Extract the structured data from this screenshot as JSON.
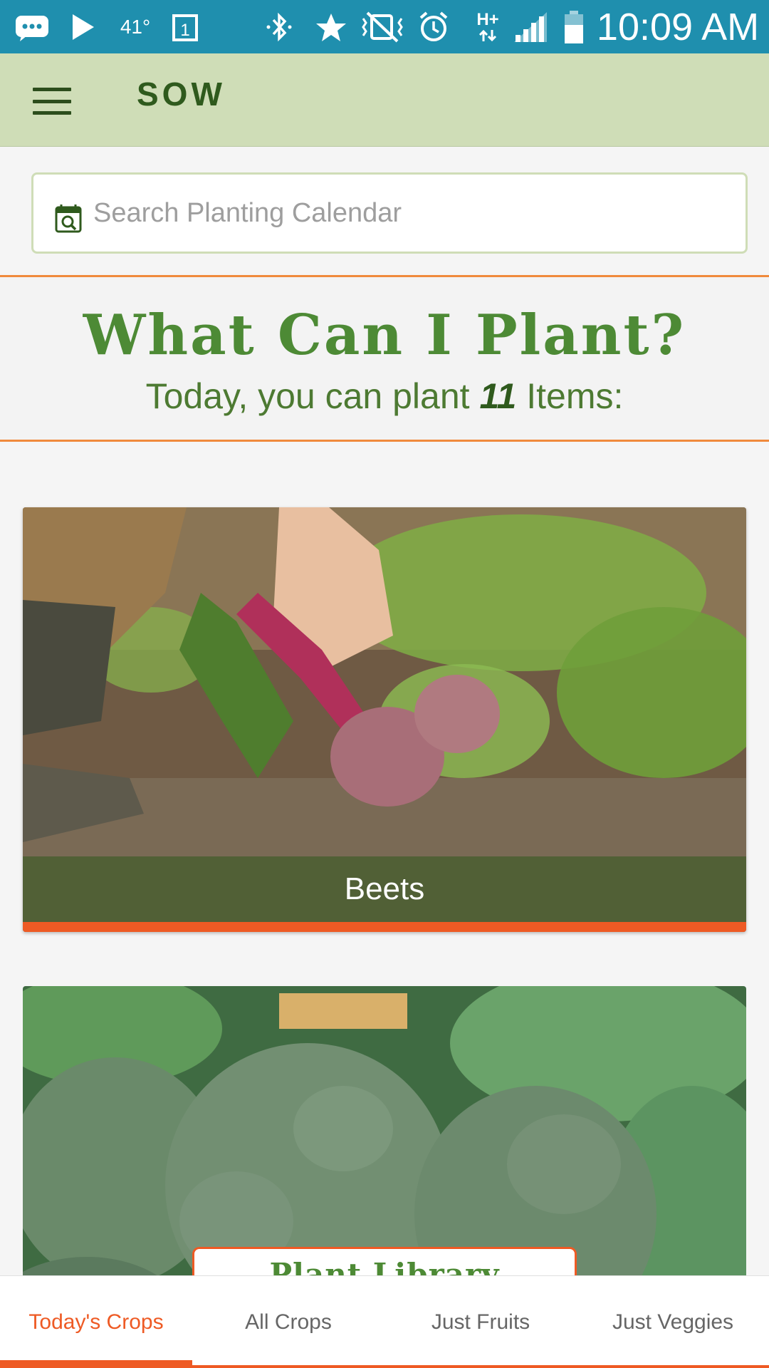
{
  "status_bar": {
    "temperature": "41°",
    "time": "10:09 AM",
    "network": "H+",
    "icons": [
      "message-icon",
      "play-icon",
      "calendar-icon",
      "bluetooth-icon",
      "star-icon",
      "vibrate-mute-icon",
      "alarm-icon",
      "network-data-icon",
      "signal-icon",
      "battery-icon"
    ]
  },
  "app_bar": {
    "title": "SOW",
    "menu_icon": "hamburger-menu-icon"
  },
  "search": {
    "placeholder": "Search Planting Calendar",
    "icon": "calendar-search-icon"
  },
  "header": {
    "headline": "What Can I Plant?",
    "subline_prefix": "Today, you can plant ",
    "count": "11",
    "subline_suffix": " Items:"
  },
  "crops": [
    {
      "name": "Beets"
    },
    {
      "name": ""
    }
  ],
  "plant_library": {
    "label": "Plant Library"
  },
  "bottom_nav": {
    "tabs": [
      {
        "label": "Today's Crops",
        "active": true
      },
      {
        "label": "All Crops",
        "active": false
      },
      {
        "label": "Just Fruits",
        "active": false
      },
      {
        "label": "Just Veggies",
        "active": false
      }
    ]
  },
  "colors": {
    "status_bar": "#1f8fae",
    "app_bar": "#cfddb7",
    "brand_green": "#4d8a35",
    "accent_orange": "#ee5a24",
    "header_border": "#f08a3c"
  }
}
